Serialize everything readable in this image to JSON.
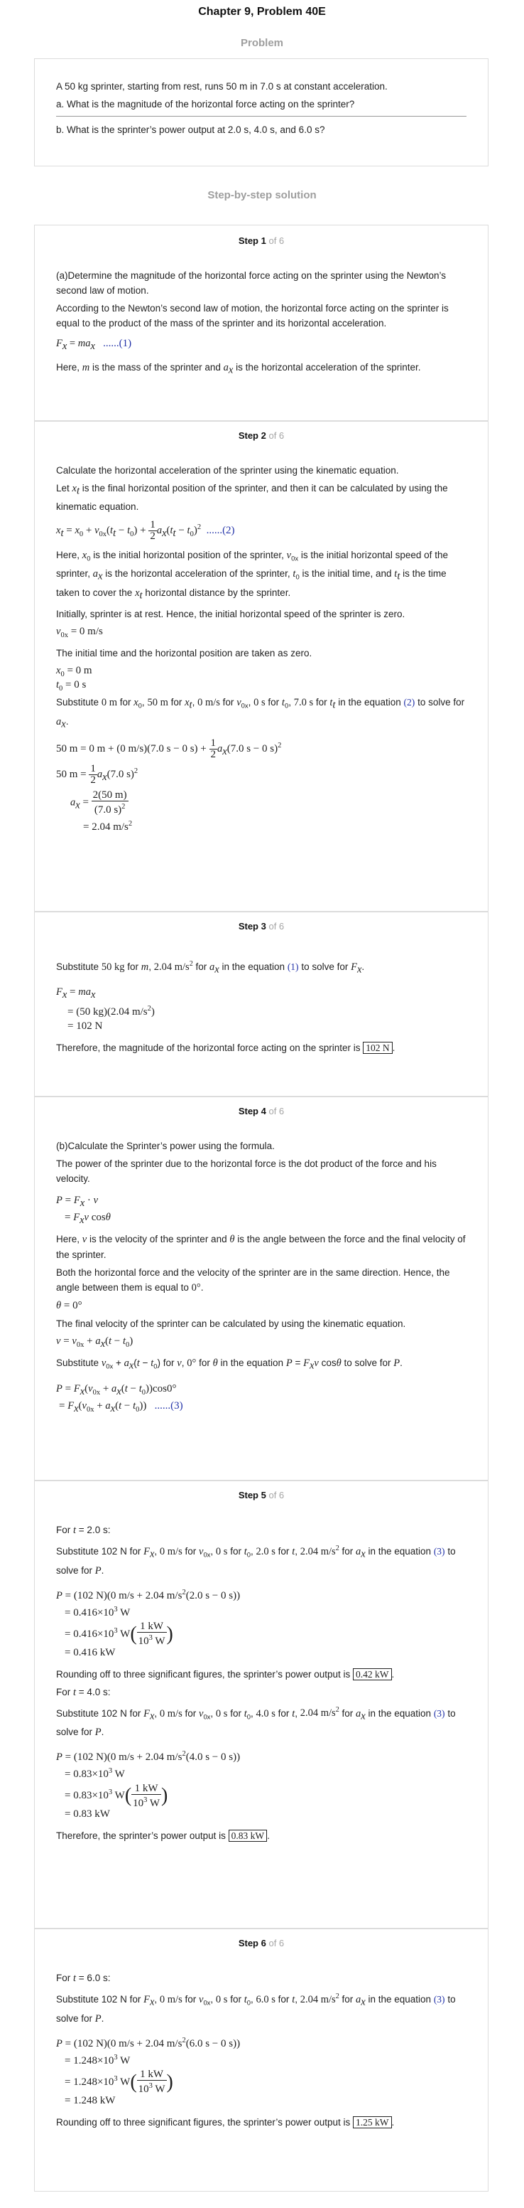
{
  "page": {
    "title": "Chapter 9, Problem 40E",
    "problem_heading": "Problem",
    "solution_heading": "Step-by-step solution"
  },
  "problem": {
    "statement": "A 50 kg sprinter, starting from rest, runs 50 m in 7.0 s at constant acceleration.",
    "part_a": "a. What is the magnitude of the horizontal force acting on the sprinter?",
    "part_b": "b. What is the sprinter’s power output at 2.0 s, 4.0 s, and 6.0 s?"
  },
  "steps": [
    {
      "label": "Step 1",
      "of": "of 6",
      "p1": "(a)Determine the magnitude of the horizontal force acting on the sprinter using the Newton’s second law of motion.",
      "p2": "According to the Newton’s second law of motion, the horizontal force acting on the sprinter is equal to the product of the mass of the sprinter and its horizontal acceleration.",
      "eq_ref": "......(1)",
      "p3_a": "Here,",
      "p3_b": "is the mass of the sprinter and",
      "p3_c": "is the horizontal acceleration of the sprinter."
    },
    {
      "label": "Step 2",
      "of": "of 6",
      "p1": "Calculate the horizontal acceleration of the sprinter using the kinematic equation.",
      "p2_a": "Let",
      "p2_b": "is the final horizontal position of the sprinter, and then it can be calculated by using the kinematic equation.",
      "eq_ref": "......(2)",
      "p3_a": "Here,",
      "p3_b": "is the initial horizontal position of the sprinter,",
      "p3_c": "is the initial horizontal speed of the sprinter,",
      "p3_d": "is the horizontal acceleration of the sprinter,",
      "p3_e": "is the initial time, and",
      "p3_f": "is the time taken to cover the",
      "p3_g": "horizontal distance by the sprinter.",
      "p4": "Initially, sprinter is at rest. Hence, the initial horizontal speed of the sprinter is zero.",
      "p5": "The initial time and the horizontal position are taken as zero.",
      "p6_a": "Substitute",
      "p6_b": "for",
      "p6_c": "in the equation",
      "p6_ref": "(2)",
      "p6_d": "to solve for"
    },
    {
      "label": "Step 3",
      "of": "of 6",
      "p1_a": "Substitute",
      "p1_b": "for",
      "p1_c": "in the equation",
      "p1_ref": "(1)",
      "p1_d": "to solve for",
      "p2": "Therefore, the magnitude of the horizontal force acting on the sprinter is",
      "answer": "102 N"
    },
    {
      "label": "Step 4",
      "of": "of 6",
      "p1": "(b)Calculate the Sprinter’s power using the formula.",
      "p2": "The power of the sprinter due to the horizontal force is the dot product of the force and his velocity.",
      "p3_a": "Here,",
      "p3_b": "is the velocity of the sprinter and",
      "p3_c": "is the angle between the force and the final velocity of the sprinter.",
      "p4": "Both the horizontal force and the velocity of the sprinter are in the same direction. Hence, the angle between them is equal to",
      "p5": "The final velocity of the sprinter can be calculated by using the kinematic equation.",
      "p6_a": "Substitute",
      "p6_b": "for",
      "p6_c": "for",
      "p6_d": "in the equation",
      "p6_e": "to solve for",
      "eq_ref": "......(3)"
    },
    {
      "label": "Step 5",
      "of": "of 6",
      "for_a": "For",
      "sub_a": "Substitute 102 N for",
      "sub_b": "for",
      "sub_c": "in the equation",
      "sub_ref": "(3)",
      "sub_d": "to solve for",
      "round": "Rounding off to three significant figures, the sprinter’s power output is",
      "answer1": "0.42 kW",
      "therefore": "Therefore, the sprinter’s power output is",
      "answer2": "0.83 kW"
    },
    {
      "label": "Step 6",
      "of": "of 6",
      "answer": "1.25 kW"
    }
  ]
}
